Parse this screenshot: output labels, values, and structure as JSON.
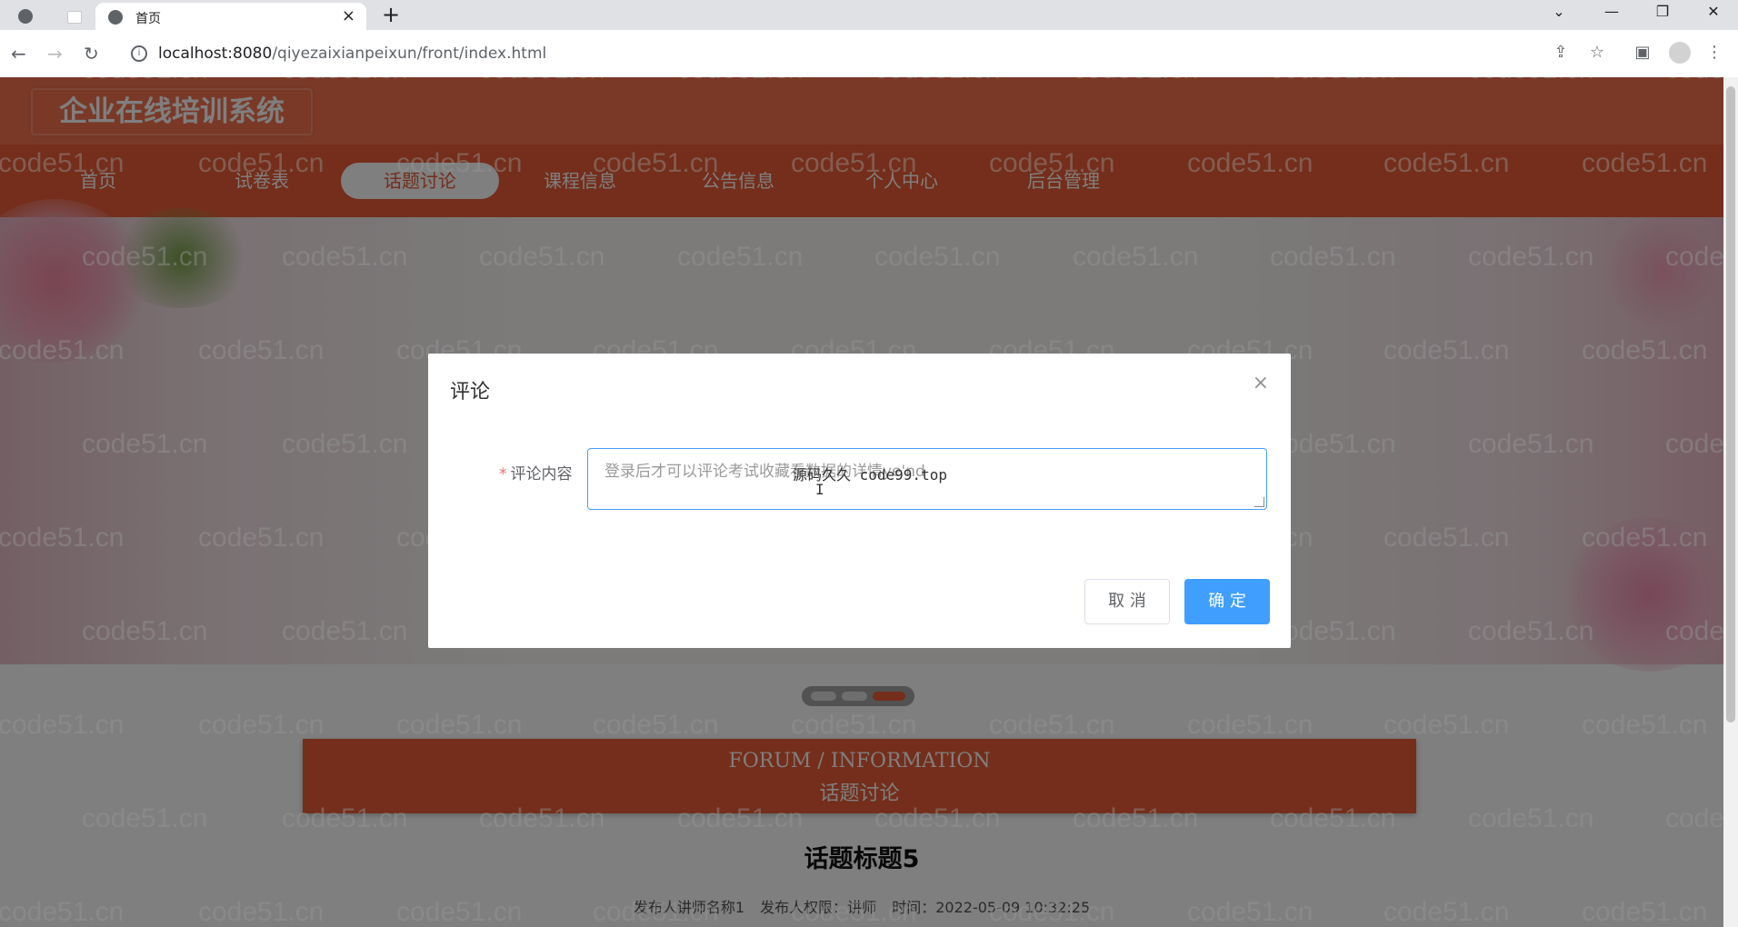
{
  "browser": {
    "tab_title": "首页",
    "new_tab": "+",
    "close_tab": "×",
    "url_host": "localhost:8080",
    "url_path": "/qiyezaixianpeixun/front/index.html",
    "win_minimize": "—",
    "win_restore": "❐",
    "win_close": "✕",
    "win_chevron": "⌄"
  },
  "site": {
    "logo": "企业在线培训系统",
    "nav": [
      {
        "label": "首页"
      },
      {
        "label": "试卷表"
      },
      {
        "label": "话题讨论"
      },
      {
        "label": "课程信息"
      },
      {
        "label": "公告信息"
      },
      {
        "label": "个人中心"
      },
      {
        "label": "后台管理"
      }
    ],
    "active_nav": "话题讨论"
  },
  "section": {
    "en": "FORUM / INFORMATION",
    "cn": "话题讨论"
  },
  "post": {
    "title": "话题标题5",
    "author": "发布人讲师名称1",
    "role": "发布人权限：讲师",
    "time": "时间：2022-05-09 10:32:25"
  },
  "dialog": {
    "title": "评论",
    "close": "×",
    "field_label": "评论内容",
    "required_mark": "*",
    "placeholder": "登录后才可以评论考试收藏看数据的详情ye'nd",
    "typed_value": "源码久久 code99.top",
    "cancel_label": "取 消",
    "ok_label": "确 定"
  },
  "watermark_text": "code51.cn",
  "colors": {
    "brand": "#f4724f",
    "menu": "#e95c37",
    "primary_button": "#409eff"
  }
}
